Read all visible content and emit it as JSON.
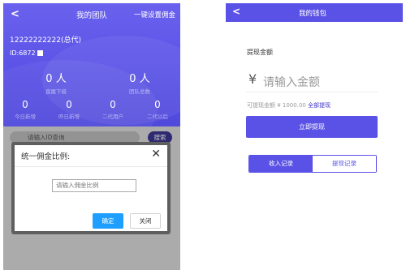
{
  "team_page": {
    "back": "<",
    "title": "我的团队",
    "set_all_commission": "一键设置佣金",
    "user_name": "12222222222(总代)",
    "user_id": "ID:6872",
    "stats_main": [
      {
        "value": "0 人",
        "label": "直属下级"
      },
      {
        "value": "0 人",
        "label": "团队总数"
      }
    ],
    "stats_sub": [
      {
        "value": "0",
        "label": "今日新增"
      },
      {
        "value": "0",
        "label": "昨日新增"
      },
      {
        "value": "0",
        "label": "二代用户"
      },
      {
        "value": "0",
        "label": "二代以后"
      }
    ],
    "search_placeholder": "请输入ID查询",
    "search_button": "搜索",
    "dialog": {
      "title": "统一佣金比例:",
      "close": "✕",
      "input_placeholder": "请输入佣金比例",
      "ok": "确定",
      "cancel": "关闭"
    }
  },
  "wallet_page": {
    "back": "<",
    "title": "我的钱包",
    "amount_label": "提现金额",
    "currency": "¥",
    "amount_placeholder": "请输入金额",
    "available_prefix": "可提现金额 ¥ 1000.00",
    "withdraw_all": "全部提现",
    "withdraw_button": "立即提现",
    "tabs": [
      "收入记录",
      "提现记录"
    ]
  },
  "colors": {
    "primary": "#5a52e6",
    "dialog_ok": "#1e9fff",
    "search_button": "#3b3590"
  }
}
